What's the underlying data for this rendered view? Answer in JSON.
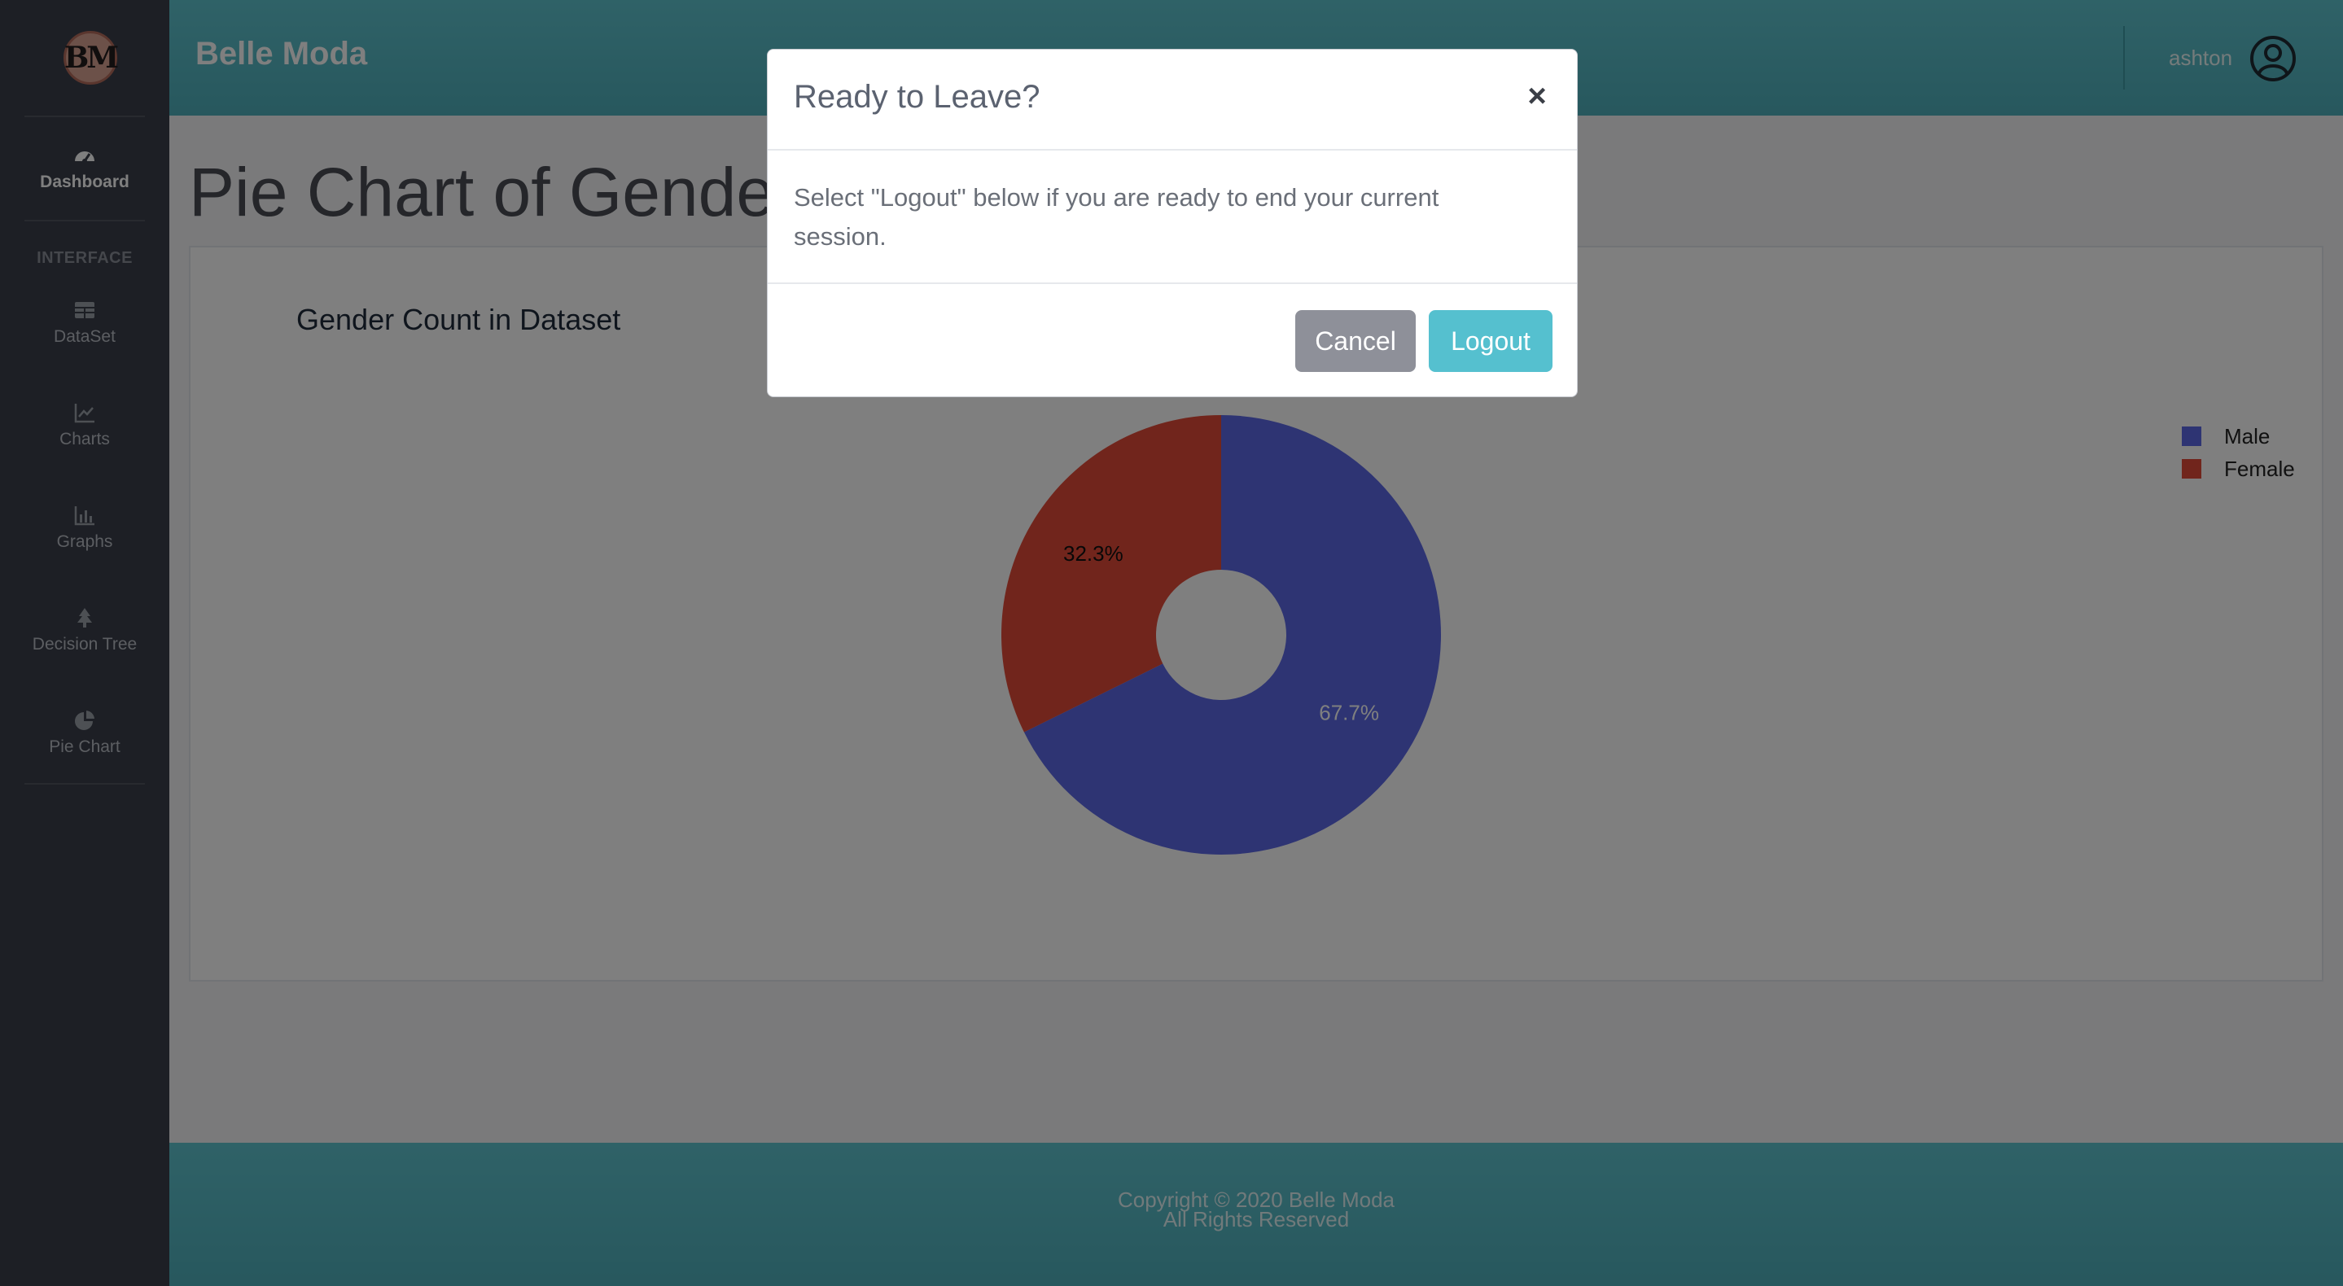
{
  "brand": {
    "logo_text": "BM",
    "app_title": "Belle Moda"
  },
  "sidebar": {
    "dashboard": "Dashboard",
    "section_heading": "INTERFACE",
    "items": [
      {
        "label": "DataSet",
        "icon": "table-icon"
      },
      {
        "label": "Charts",
        "icon": "line-chart-icon"
      },
      {
        "label": "Graphs",
        "icon": "bar-chart-icon"
      },
      {
        "label": "Decision Tree",
        "icon": "tree-icon"
      },
      {
        "label": "Pie Chart",
        "icon": "pie-chart-icon"
      }
    ]
  },
  "topbar": {
    "username": "ashton"
  },
  "main": {
    "page_title": "Pie Chart of Gender"
  },
  "chart_data": {
    "type": "pie",
    "title": "Gender Count in Dataset",
    "labels": [
      "Male",
      "Female"
    ],
    "values": [
      67.7,
      32.3
    ],
    "value_labels": [
      "67.7%",
      "32.3%"
    ],
    "colors": [
      "#5c68e6",
      "#e34b38"
    ],
    "legend_position": "right",
    "hole": true
  },
  "footer": {
    "line1": "Copyright © 2020 Belle Moda",
    "line2": "All Rights Reserved"
  },
  "modal": {
    "title": "Ready to Leave?",
    "close": "×",
    "body": "Select \"Logout\" below if you are ready to end your current session.",
    "cancel": "Cancel",
    "logout": "Logout"
  }
}
